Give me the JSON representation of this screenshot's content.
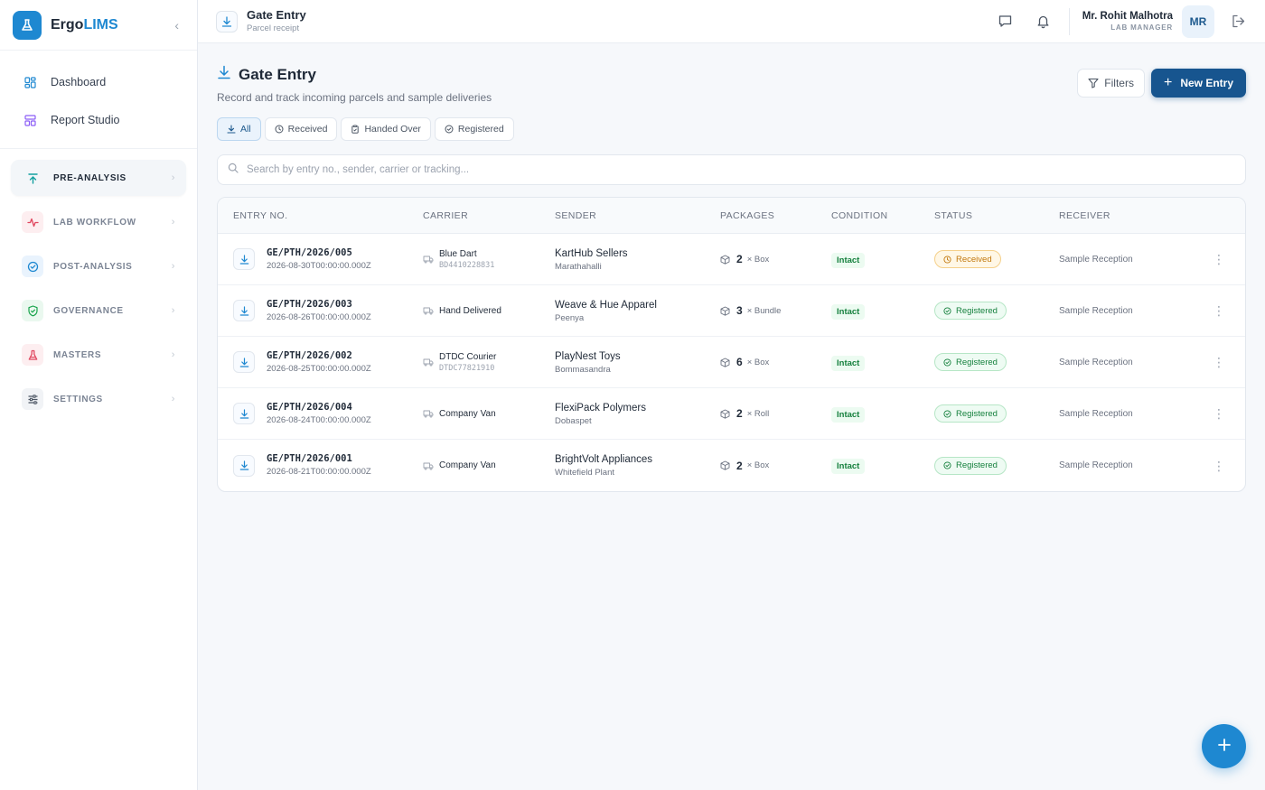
{
  "app": {
    "name_prefix": "Ergo",
    "name_accent": "LIMS"
  },
  "sidebar": {
    "top_links": [
      {
        "label": "Dashboard",
        "icon": "grid-icon"
      },
      {
        "label": "Report Studio",
        "icon": "layout-icon"
      }
    ],
    "sections": [
      {
        "label": "PRE-ANALYSIS",
        "icon": "upload-arrow-icon",
        "active": true
      },
      {
        "label": "LAB WORKFLOW",
        "icon": "activity-icon"
      },
      {
        "label": "POST-ANALYSIS",
        "icon": "check-circle-icon"
      },
      {
        "label": "GOVERNANCE",
        "icon": "shield-check-icon"
      },
      {
        "label": "MASTERS",
        "icon": "flask-icon"
      },
      {
        "label": "SETTINGS",
        "icon": "sliders-icon"
      }
    ]
  },
  "topbar": {
    "title": "Gate Entry",
    "subtitle": "Parcel receipt",
    "user_name": "Mr. Rohit Malhotra",
    "user_role": "LAB MANAGER",
    "avatar_initials": "MR"
  },
  "page": {
    "title": "Gate Entry",
    "description": "Record and track incoming parcels and sample deliveries",
    "filters_label": "Filters",
    "new_entry_label": "New Entry",
    "tabs": [
      {
        "label": "All",
        "icon": "download-icon",
        "active": true
      },
      {
        "label": "Received",
        "icon": "clock-icon"
      },
      {
        "label": "Handed Over",
        "icon": "clipboard-icon"
      },
      {
        "label": "Registered",
        "icon": "check-circle-icon"
      }
    ],
    "search_placeholder": "Search by entry no., sender, carrier or tracking..."
  },
  "table": {
    "headers": [
      "ENTRY NO.",
      "CARRIER",
      "SENDER",
      "PACKAGES",
      "CONDITION",
      "STATUS",
      "RECEIVER"
    ],
    "rows": [
      {
        "entry_no": "GE/PTH/2026/005",
        "date": "2026-08-30T00:00:00.000Z",
        "carrier": "Blue Dart",
        "tracking": "BD4410228831",
        "sender": "KartHub Sellers",
        "location": "Marathahalli",
        "count": "2",
        "unit": "× Box",
        "condition": "Intact",
        "status": "Received",
        "receiver": "Sample Reception"
      },
      {
        "entry_no": "GE/PTH/2026/003",
        "date": "2026-08-26T00:00:00.000Z",
        "carrier": "Hand Delivered",
        "tracking": "",
        "sender": "Weave & Hue Apparel",
        "location": "Peenya",
        "count": "3",
        "unit": "× Bundle",
        "condition": "Intact",
        "status": "Registered",
        "receiver": "Sample Reception"
      },
      {
        "entry_no": "GE/PTH/2026/002",
        "date": "2026-08-25T00:00:00.000Z",
        "carrier": "DTDC Courier",
        "tracking": "DTDC77821910",
        "sender": "PlayNest Toys",
        "location": "Bommasandra",
        "count": "6",
        "unit": "× Box",
        "condition": "Intact",
        "status": "Registered",
        "receiver": "Sample Reception"
      },
      {
        "entry_no": "GE/PTH/2026/004",
        "date": "2026-08-24T00:00:00.000Z",
        "carrier": "Company Van",
        "tracking": "",
        "sender": "FlexiPack Polymers",
        "location": "Dobaspet",
        "count": "2",
        "unit": "× Roll",
        "condition": "Intact",
        "status": "Registered",
        "receiver": "Sample Reception"
      },
      {
        "entry_no": "GE/PTH/2026/001",
        "date": "2026-08-21T00:00:00.000Z",
        "carrier": "Company Van",
        "tracking": "",
        "sender": "BrightVolt Appliances",
        "location": "Whitefield Plant",
        "count": "2",
        "unit": "× Box",
        "condition": "Intact",
        "status": "Registered",
        "receiver": "Sample Reception"
      }
    ]
  },
  "colors": {
    "brand": "#1e88d1",
    "primary_button": "#17558f",
    "received": "#c2780d",
    "registered": "#15803d"
  }
}
